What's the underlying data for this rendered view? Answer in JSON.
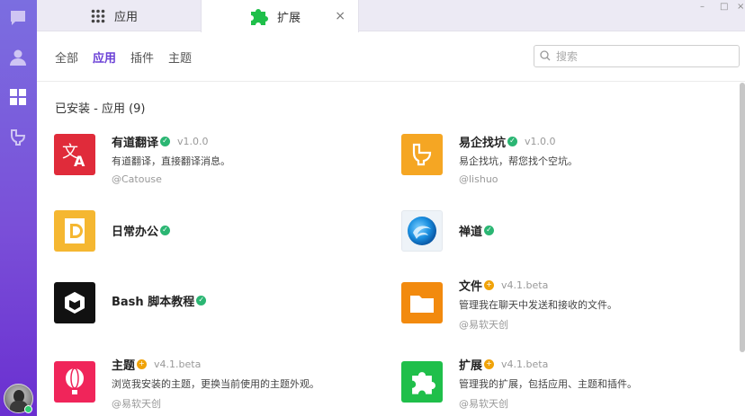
{
  "window": {
    "minimize": "–",
    "maximize": "□",
    "close": "×"
  },
  "tabs": [
    {
      "label": "应用",
      "icon": "grid-icon"
    },
    {
      "label": "扩展",
      "icon": "puzzle-icon",
      "close": "×"
    }
  ],
  "filters": [
    "全部",
    "应用",
    "插件",
    "主题"
  ],
  "active_filter": "应用",
  "search": {
    "placeholder": "搜索"
  },
  "section_title": "已安装 - 应用 (9)",
  "apps": [
    {
      "name": "有道翻译",
      "badge": "verified",
      "version": "v1.0.0",
      "desc": "有道翻译，直接翻译消息。",
      "author": "@Catouse",
      "icon": "translate-icon",
      "color": "#e02b3a"
    },
    {
      "name": "易企找坑",
      "badge": "verified",
      "version": "v1.0.0",
      "desc": "易企找坑，帮您找个空坑。",
      "author": "@lishuo",
      "icon": "toilet-icon",
      "color": "#f5a623"
    },
    {
      "name": "日常办公",
      "badge": "verified",
      "version": "",
      "desc": "",
      "author": "",
      "icon": "daily-office-icon",
      "color": "#f5b731"
    },
    {
      "name": "禅道",
      "badge": "verified",
      "version": "",
      "desc": "",
      "author": "",
      "icon": "zentao-logo-icon",
      "color": "#1e8bd8"
    },
    {
      "name": "Bash 脚本教程",
      "badge": "verified",
      "version": "",
      "desc": "",
      "author": "",
      "icon": "cube-icon",
      "color": "#111111"
    },
    {
      "name": "文件",
      "badge": "plus",
      "version": "v4.1.beta",
      "desc": "管理我在聊天中发送和接收的文件。",
      "author": "@易软天创",
      "icon": "folder-icon",
      "color": "#f28a0e"
    },
    {
      "name": "主题",
      "badge": "plus",
      "version": "v4.1.beta",
      "desc": "浏览我安装的主题，更换当前使用的主题外观。",
      "author": "@易软天创",
      "icon": "balloon-icon",
      "color": "#f0255a"
    },
    {
      "name": "扩展",
      "badge": "plus",
      "version": "v4.1.beta",
      "desc": "管理我的扩展，包括应用、主题和插件。",
      "author": "@易软天创",
      "icon": "puzzle-icon",
      "color": "#1fbf4a"
    }
  ]
}
